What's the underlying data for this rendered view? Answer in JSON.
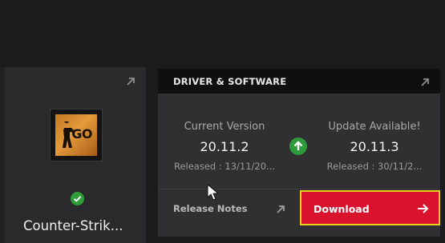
{
  "game_card": {
    "title": "Counter-Strik...",
    "art_text": "GO",
    "status": "installed"
  },
  "driver_panel": {
    "title": "DRIVER & SOFTWARE",
    "current": {
      "label": "Current Version",
      "version": "20.11.2",
      "released": "Released : 13/11/20..."
    },
    "update": {
      "label": "Update Available!",
      "version": "20.11.3",
      "released": "Released : 30/11/2..."
    },
    "release_notes_label": "Release Notes",
    "download_label": "Download"
  },
  "colors": {
    "accent_red": "#d9132e",
    "highlight_yellow": "#e7d11d",
    "status_green": "#2f9a3b"
  },
  "icons": {
    "expand": "expand-arrow-icon",
    "check": "check-icon",
    "update": "up-arrow-icon",
    "download": "right-arrow-icon"
  }
}
